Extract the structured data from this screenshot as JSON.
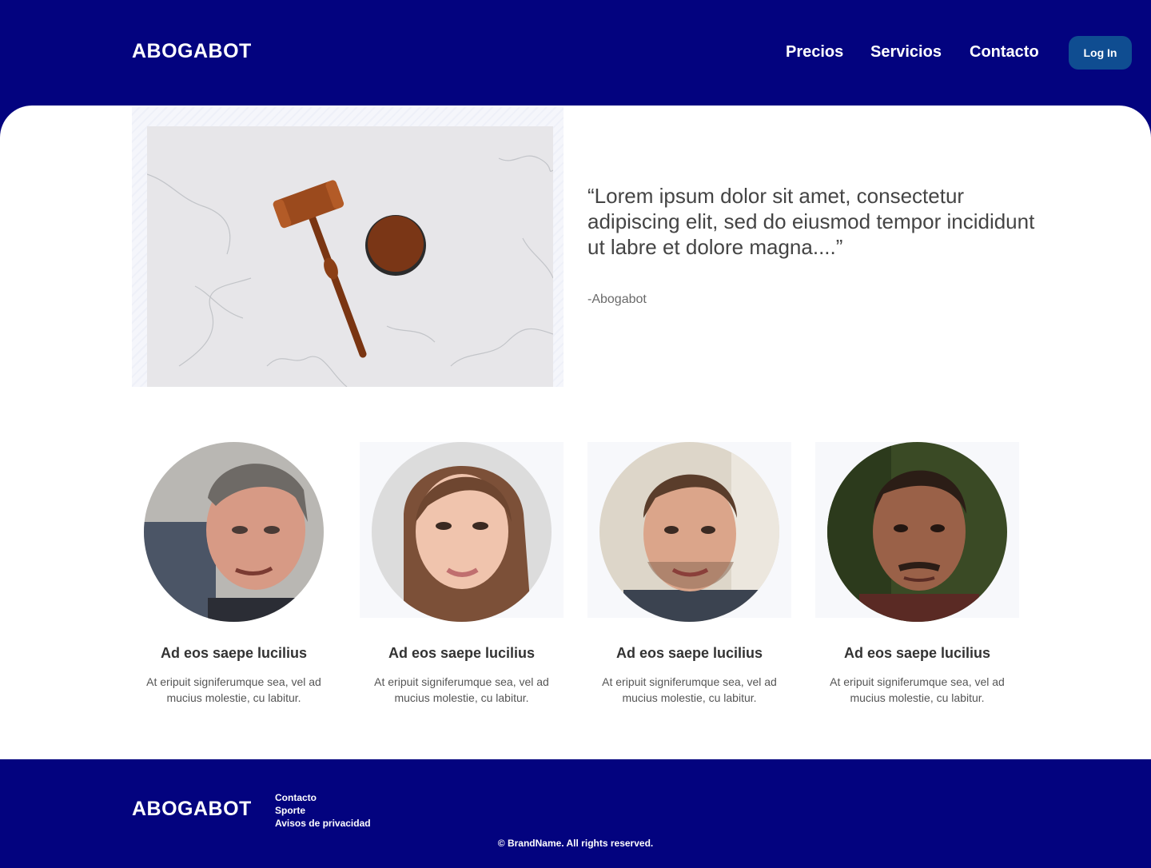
{
  "header": {
    "brand": "ABOGABOT",
    "nav": [
      "Precios",
      "Servicios",
      "Contacto"
    ],
    "login_label": "Log In"
  },
  "hero": {
    "image_icon": "gavel-image",
    "quote": "“Lorem ipsum dolor sit amet, consectetur adipiscing elit, sed do eiusmod tempor incididunt ut labre et dolore magna....”",
    "author": "-Abogabot"
  },
  "team": [
    {
      "name": "Ad eos saepe lucilius",
      "desc": "At eripuit signiferumque sea, vel ad mucius molestie, cu labitur."
    },
    {
      "name": "Ad eos saepe lucilius",
      "desc": "At eripuit signiferumque sea, vel ad mucius molestie, cu labitur."
    },
    {
      "name": "Ad eos saepe lucilius",
      "desc": "At eripuit signiferumque sea, vel ad mucius molestie, cu labitur."
    },
    {
      "name": "Ad eos saepe lucilius",
      "desc": "At eripuit signiferumque sea, vel ad mucius molestie, cu labitur."
    }
  ],
  "footer": {
    "brand": "ABOGABOT",
    "links": [
      "Contacto",
      "Sporte",
      "Avisos de privacidad"
    ],
    "copyright": "© BrandName. All rights reserved."
  },
  "colors": {
    "primary": "#03037f",
    "button": "#0f4d91"
  }
}
